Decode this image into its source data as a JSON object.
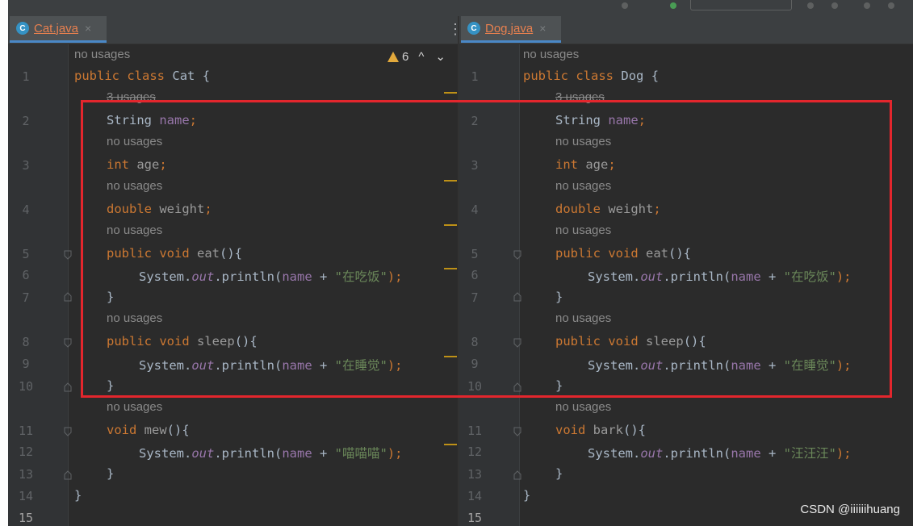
{
  "left": {
    "tab": {
      "icon": "C",
      "title": "Cat.java",
      "close": "×"
    },
    "warning": {
      "count": "6",
      "up": "^",
      "down": "⌄"
    },
    "class_name": "Cat",
    "hint_top": "no usages",
    "hint_field": "3 usages",
    "hint_no": "no usages",
    "method3": "mew",
    "s_eat": "\"在吃饭\"",
    "s_sleep": "\"在睡觉\"",
    "s_m3": "\"喵喵喵\""
  },
  "right": {
    "tab": {
      "icon": "C",
      "title": "Dog.java",
      "close": "×"
    },
    "class_name": "Dog",
    "hint_top": "no usages",
    "hint_field": "3 usages",
    "hint_no": "no usages",
    "method3": "bark",
    "s_eat": "\"在吃饭\"",
    "s_sleep": "\"在睡觉\"",
    "s_m3": "\"汪汪汪\""
  },
  "code": {
    "public": "public",
    "class": "class",
    "brace_open": " {",
    "brace_close": "}",
    "type_string": "String",
    "field_name": "name",
    "semi": ";",
    "type_int": "int",
    "field_age": "age",
    "type_double": "double",
    "field_weight": "weight",
    "kw_void": "void",
    "m_eat": "eat",
    "m_sleep": "sleep",
    "paren_brace": "(){",
    "system": "System.",
    "out": "out",
    "println": ".println(",
    "plus": " + ",
    "close_paren": ");"
  },
  "line_numbers": [
    "1",
    "2",
    "3",
    "4",
    "5",
    "6",
    "7",
    "8",
    "9",
    "10",
    "11",
    "12",
    "13",
    "14",
    "15"
  ],
  "menu_dots": "⋮",
  "watermark": "CSDN @iiiiiihuang",
  "colors": {
    "keyword": "#cc7832",
    "field": "#9876aa",
    "string": "#6a8759",
    "highlight_box": "#e3262d",
    "tab_text": "#e8804f"
  }
}
